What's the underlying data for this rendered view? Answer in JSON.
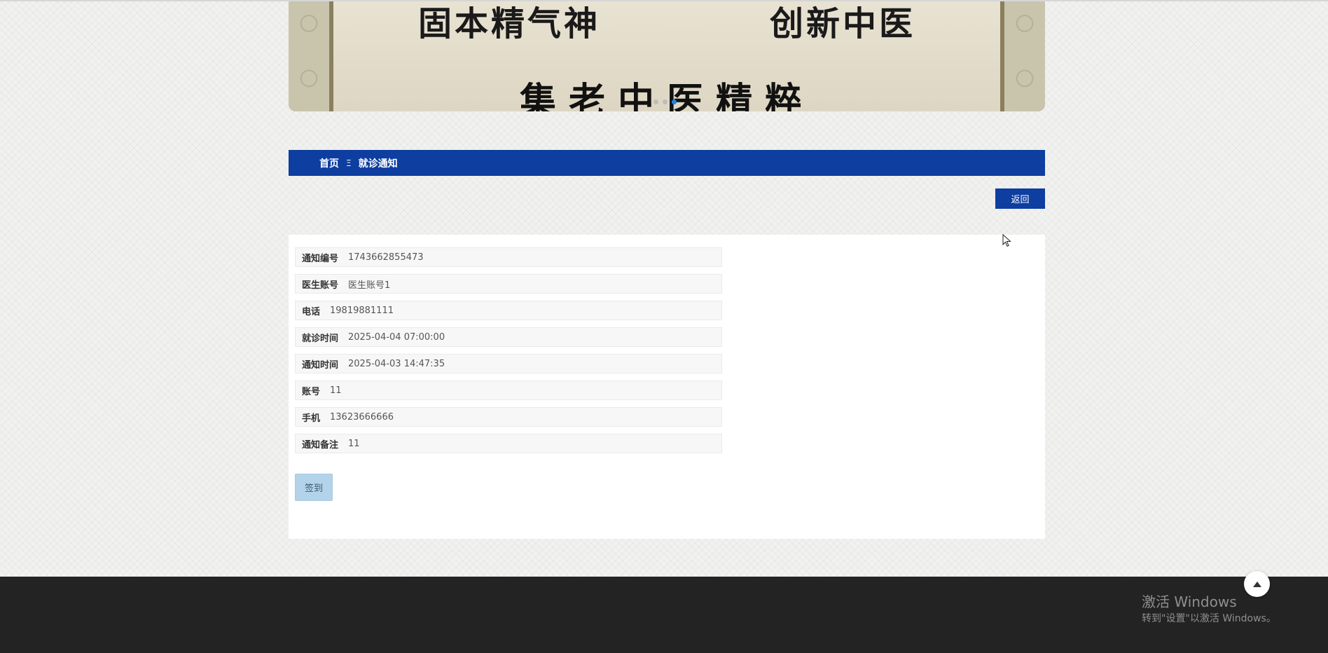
{
  "banner": {
    "line1_left": "固本精气神",
    "line1_right": "创新中医",
    "line2": "集老中医精粹",
    "dot_count": 3,
    "active_dot_index": 2
  },
  "breadcrumb": {
    "home": "首页",
    "separator": "Ξ",
    "current": "就诊通知"
  },
  "actions": {
    "back_label": "返回",
    "sign_in_label": "签到"
  },
  "fields": [
    {
      "label": "通知编号",
      "value": "1743662855473"
    },
    {
      "label": "医生账号",
      "value": "医生账号1"
    },
    {
      "label": "电话",
      "value": "19819881111"
    },
    {
      "label": "就诊时间",
      "value": "2025-04-04 07:00:00"
    },
    {
      "label": "通知时间",
      "value": "2025-04-03 14:47:35"
    },
    {
      "label": "账号",
      "value": "11"
    },
    {
      "label": "手机",
      "value": "13623666666"
    },
    {
      "label": "通知备注",
      "value": "11"
    }
  ],
  "watermark": {
    "title": "激活 Windows",
    "subtitle": "转到\"设置\"以激活 Windows。"
  },
  "colors": {
    "primary": "#0d3ea0",
    "footer": "#232323",
    "sign_button": "#b3d3ea"
  }
}
